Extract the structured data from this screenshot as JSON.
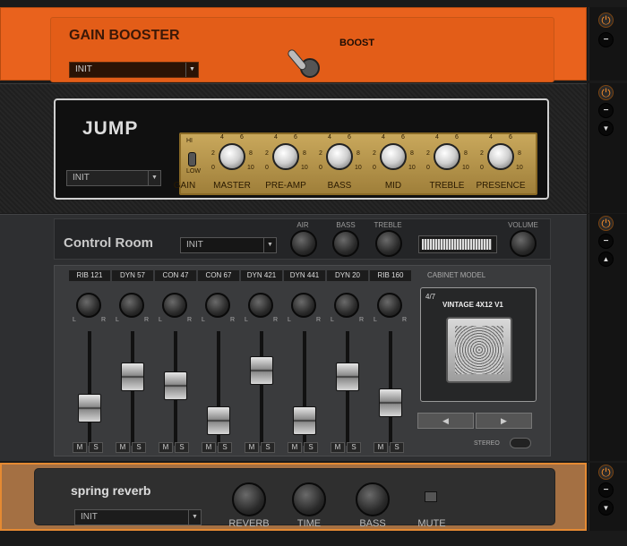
{
  "gain_booster": {
    "title": "GAIN BOOSTER",
    "preset": "INIT",
    "boost_label": "BOOST"
  },
  "jump": {
    "title": "JUMP",
    "preset": "INIT",
    "switch": {
      "hi": "HI",
      "low": "LOW",
      "label": "GAIN"
    },
    "knobs": [
      {
        "label": "MASTER"
      },
      {
        "label": "PRE-AMP"
      },
      {
        "label": "BASS"
      },
      {
        "label": "MID"
      },
      {
        "label": "TREBLE"
      },
      {
        "label": "PRESENCE"
      }
    ],
    "scale": {
      "low": "0",
      "mid_low": "2",
      "mid1": "4",
      "mid2": "6",
      "mid_high": "8",
      "high": "10"
    }
  },
  "control_room": {
    "title": "Control Room",
    "preset": "INIT",
    "knob_labels": {
      "air": "AIR",
      "bass": "BASS",
      "treble": "TREBLE",
      "volume": "VOLUME"
    },
    "channels": [
      {
        "name": "RIB 121",
        "fader": 0.27
      },
      {
        "name": "DYN 57",
        "fader": 0.64
      },
      {
        "name": "CON 47",
        "fader": 0.53
      },
      {
        "name": "CON 67",
        "fader": 0.12
      },
      {
        "name": "DYN 421",
        "fader": 0.71
      },
      {
        "name": "DYN 441",
        "fader": 0.12
      },
      {
        "name": "DYN 20",
        "fader": 0.64
      },
      {
        "name": "RIB 160",
        "fader": 0.33
      }
    ],
    "lr": {
      "l": "L",
      "r": "R"
    },
    "ms": {
      "m": "M",
      "s": "S"
    },
    "cabinet": {
      "label": "CABINET MODEL",
      "count": "4/7",
      "name": "VINTAGE 4X12 V1",
      "prev": "◀",
      "next": "▶",
      "stereo": "STEREO"
    }
  },
  "spring_reverb": {
    "title": "spring reverb",
    "preset": "INIT",
    "knobs": [
      {
        "label": "REVERB"
      },
      {
        "label": "TIME"
      },
      {
        "label": "BASS"
      }
    ],
    "mute": "MUTE"
  },
  "icons": {
    "power": "⏻",
    "minus": "−",
    "down": "▼",
    "up": "▲",
    "dropdown": "▼"
  },
  "colors": {
    "accent": "#e9621d",
    "gold": "#c9a85c"
  }
}
